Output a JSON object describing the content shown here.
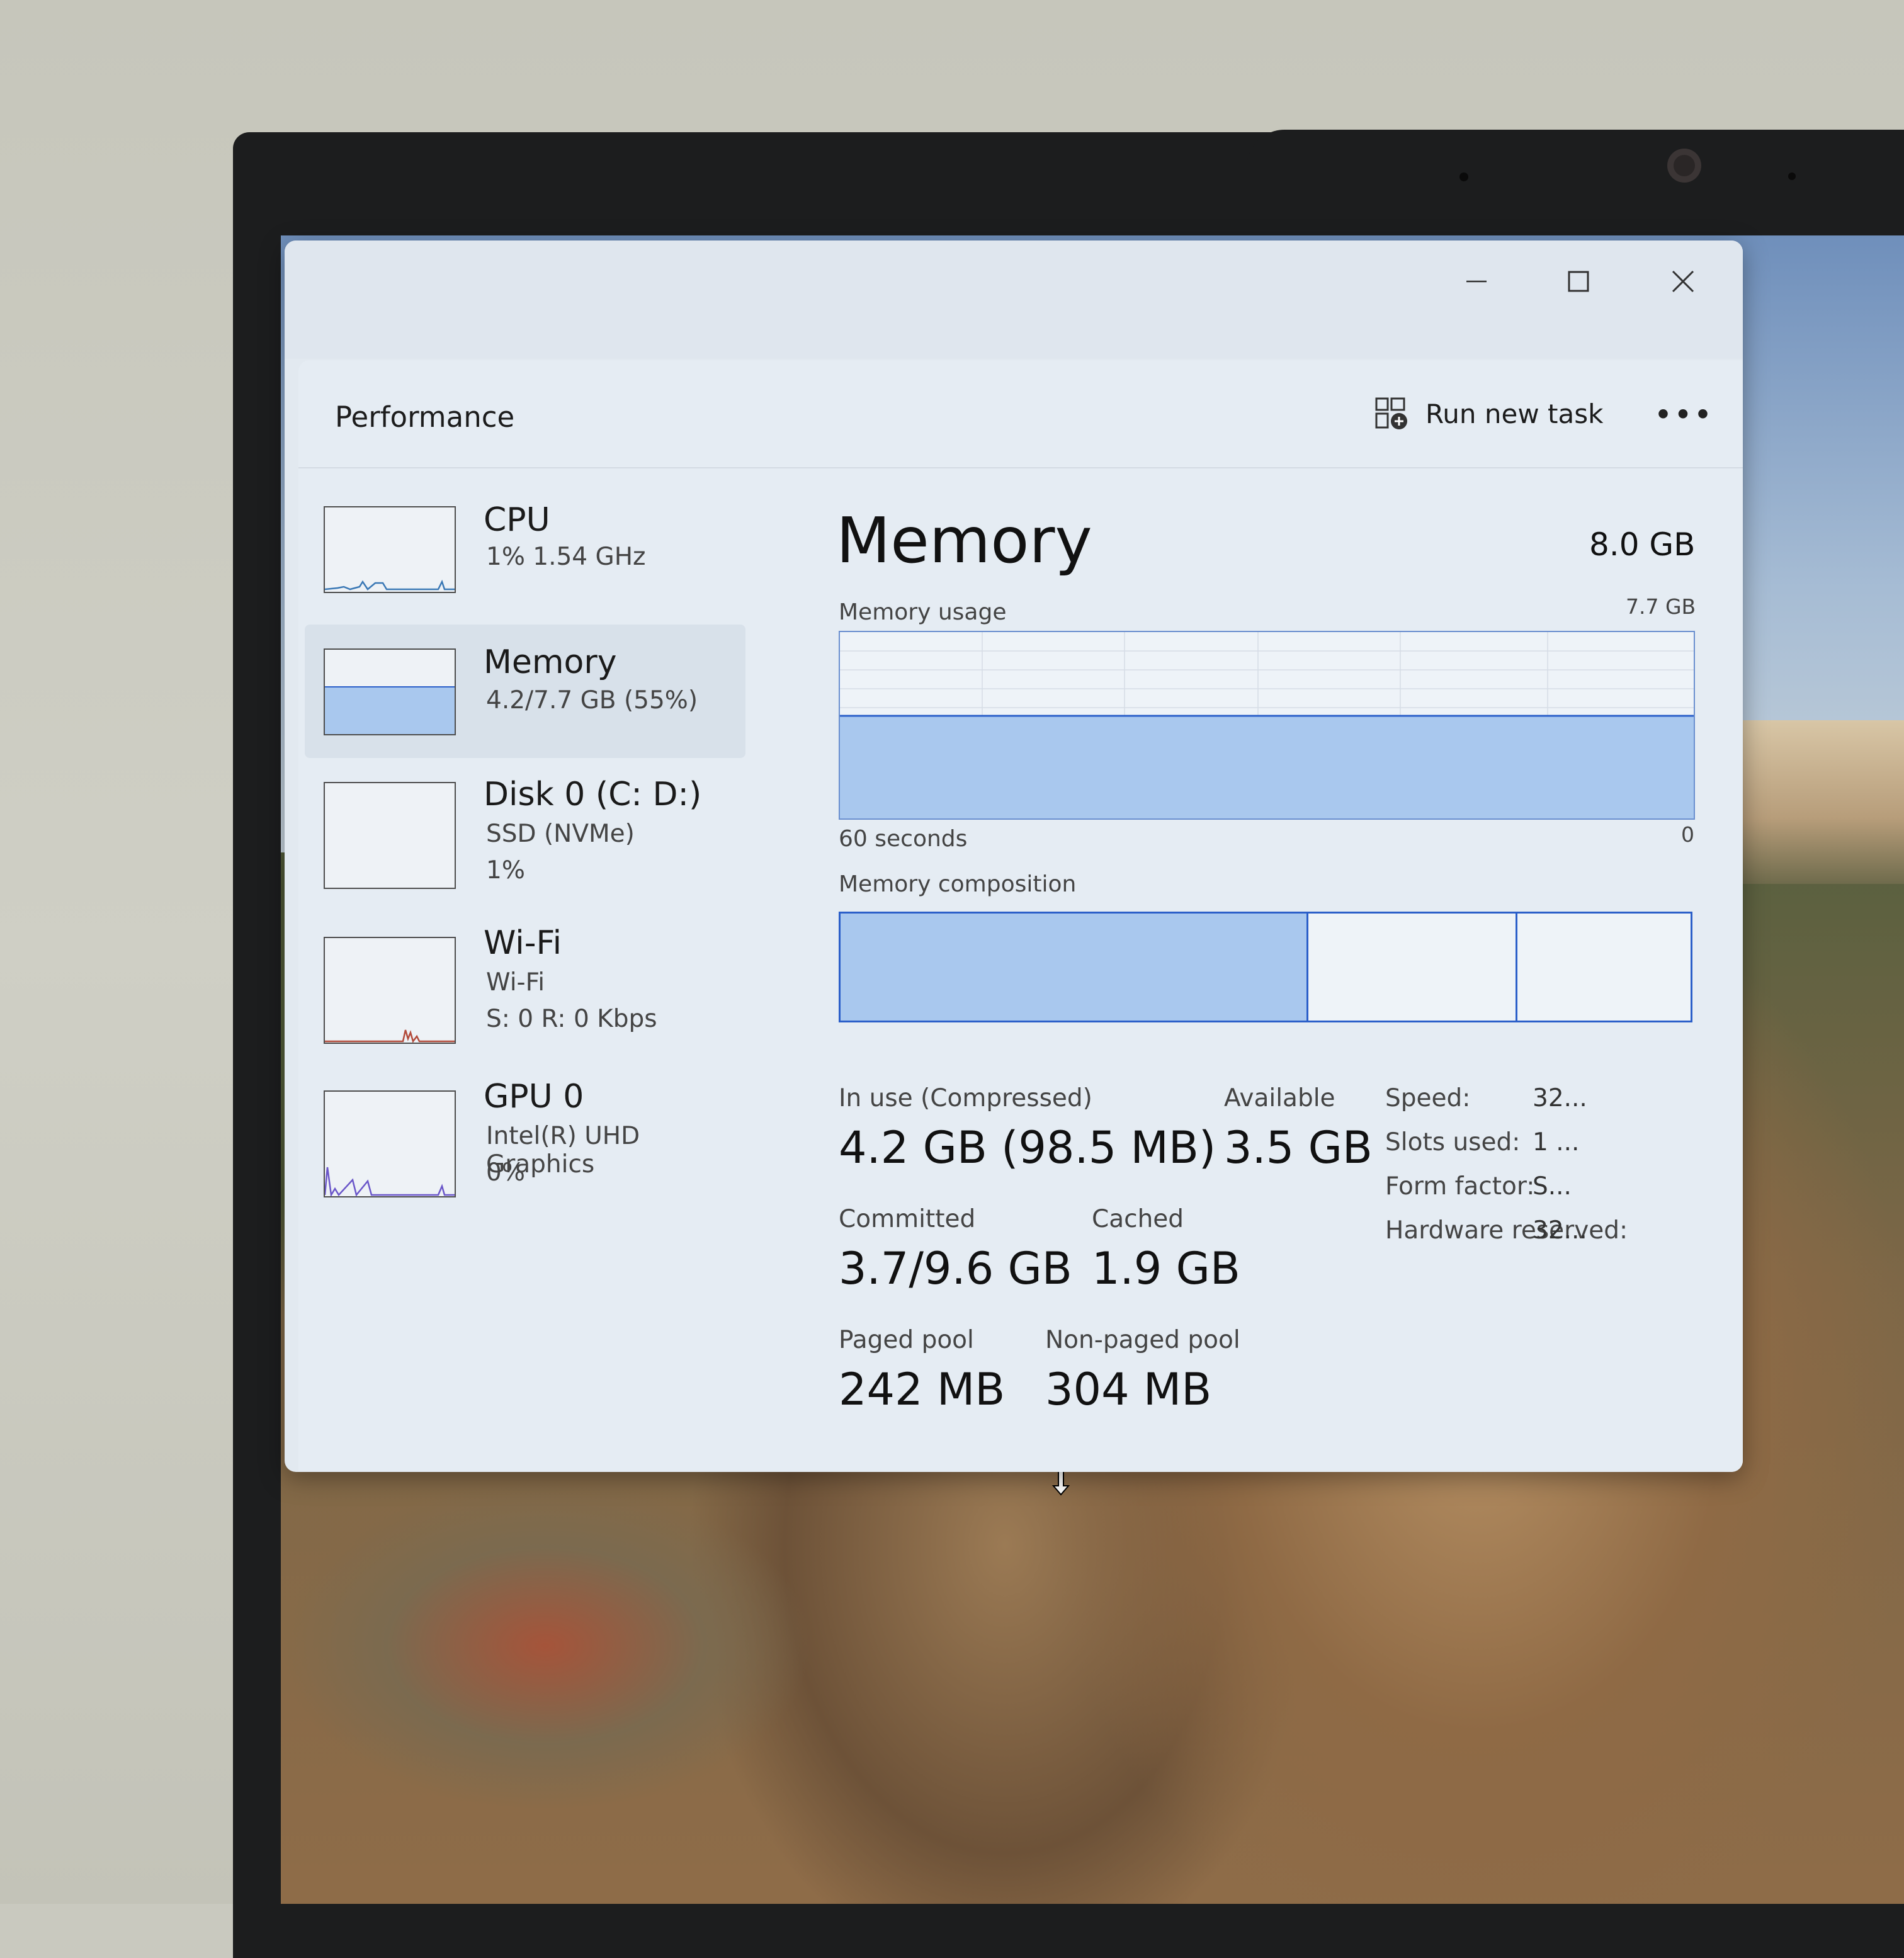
{
  "window": {
    "title": "Performance",
    "run_new_task": "Run new task",
    "more": "•••"
  },
  "sidebar": {
    "items": [
      {
        "name": "CPU",
        "line1": "1%  1.54 GHz",
        "line2": ""
      },
      {
        "name": "Memory",
        "line1": "4.2/7.7 GB (55%)",
        "line2": ""
      },
      {
        "name": "Disk 0 (C: D:)",
        "line1": "SSD (NVMe)",
        "line2": "1%"
      },
      {
        "name": "Wi-Fi",
        "line1": "Wi-Fi",
        "line2": "S: 0  R: 0 Kbps"
      },
      {
        "name": "GPU 0",
        "line1": "Intel(R) UHD Graphics",
        "line2": "0%"
      }
    ]
  },
  "main": {
    "title": "Memory",
    "total": "8.0 GB",
    "usage_label": "Memory usage",
    "usage_max": "7.7 GB",
    "time_left": "60 seconds",
    "time_right": "0",
    "usage_fraction": 0.55,
    "composition_label": "Memory composition",
    "composition": {
      "in_use": 0.55,
      "modified": 0.245,
      "standby": 0.205
    },
    "stats": {
      "in_use_label": "In use (Compressed)",
      "in_use_value": "4.2 GB (98.5 MB)",
      "available_label": "Available",
      "available_value": "3.5 GB",
      "committed_label": "Committed",
      "committed_value": "3.7/9.6 GB",
      "cached_label": "Cached",
      "cached_value": "1.9 GB",
      "paged_label": "Paged pool",
      "paged_value": "242 MB",
      "nonpaged_label": "Non-paged pool",
      "nonpaged_value": "304 MB"
    },
    "specs": {
      "speed_label": "Speed:",
      "speed_value": "32...",
      "slots_label": "Slots used:",
      "slots_value": "1 ...",
      "form_label": "Form factor:",
      "form_value": "S...",
      "hw_label": "Hardware reserved:",
      "hw_value": "32..."
    }
  },
  "colors": {
    "accent": "#2b5fc9",
    "fill": "#a9c8ee",
    "cpu_line": "#3a78b5",
    "wifi_line": "#b24a3a",
    "gpu_line": "#6a56c9"
  }
}
